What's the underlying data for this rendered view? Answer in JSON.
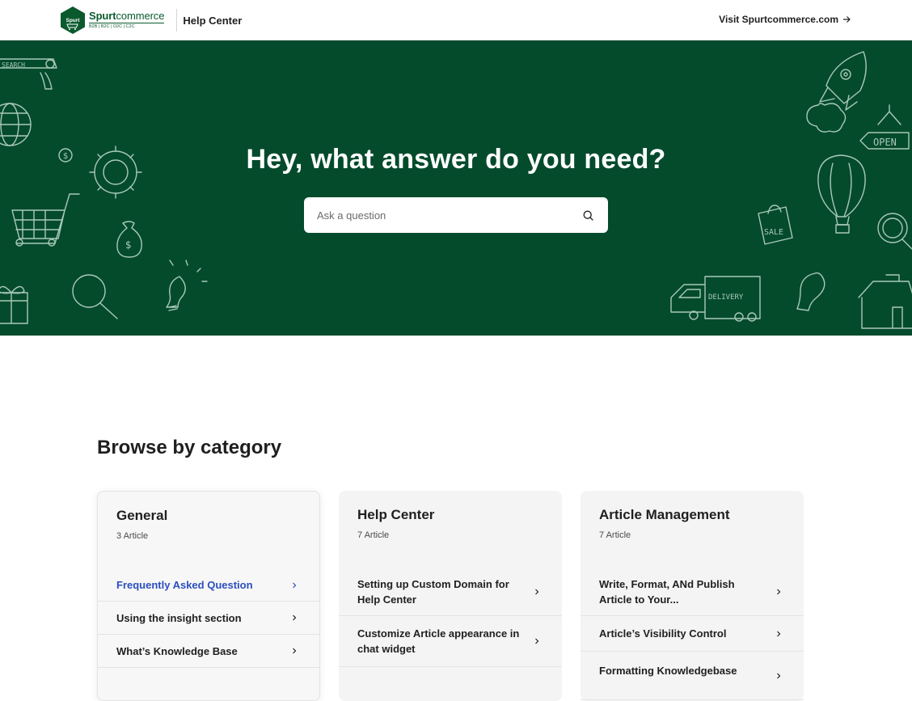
{
  "header": {
    "logo_badge": "Spurt",
    "logo_name_bold": "Spurt",
    "logo_name_rest": "commerce",
    "logo_tagline": "B2B | B2C | D2C | C2C",
    "section_label": "Help Center",
    "visit_link": "Visit Spurtcommerce.com",
    "visit_icon": "arrow-right-icon"
  },
  "hero": {
    "title": "Hey, what answer do you need?",
    "search_placeholder": "Ask a question",
    "search_icon": "search-icon",
    "doodle_words": {
      "search": "SEARCH",
      "open": "OPEN",
      "sale": "SALE",
      "delivery": "DELIVERY"
    }
  },
  "browse": {
    "title": "Browse by category",
    "categories": [
      {
        "title": "General",
        "count": "3 Article",
        "items": [
          {
            "label": "Frequently Asked Question"
          },
          {
            "label": "Using the insight section"
          },
          {
            "label": "What’s Knowledge Base"
          }
        ]
      },
      {
        "title": "Help Center",
        "count": "7 Article",
        "items": [
          {
            "label": "Setting up Custom Domain for Help Center"
          },
          {
            "label": "Customize Article appearance in chat widget"
          }
        ]
      },
      {
        "title": "Article Management",
        "count": "7 Article",
        "items": [
          {
            "label": "Write, Format, ANd Publish Article to Your..."
          },
          {
            "label": "Article’s Visibility Control"
          },
          {
            "label": "Formatting Knowledgebase"
          }
        ]
      }
    ]
  },
  "colors": {
    "brand_green": "#044b2c",
    "link_blue": "#2c4fbf",
    "card_bg": "#f4f4f4"
  }
}
